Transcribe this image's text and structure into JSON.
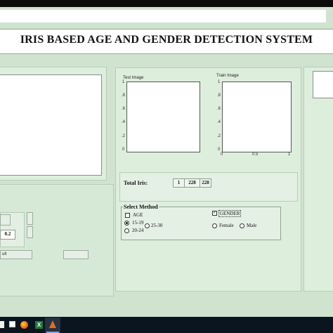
{
  "app": {
    "title": "IRIS BASED AGE AND GENDER DETECTION SYSTEM"
  },
  "plots": {
    "test": {
      "title": "Test Image",
      "yticks": [
        "1",
        ".8",
        ".6",
        ".4",
        ".2",
        "0"
      ]
    },
    "train": {
      "title": "Train Image",
      "yticks": [
        "1",
        ".8",
        ".6",
        ".4",
        ".2",
        "0"
      ],
      "xticks": [
        "0",
        "0.5",
        "1"
      ]
    }
  },
  "left": {
    "value_field": "0.2",
    "result_button": "ult"
  },
  "total": {
    "label": "Total Iris:",
    "values": [
      "1",
      "228",
      "228"
    ]
  },
  "method": {
    "legend": "Select Method",
    "age": {
      "label": "AGE",
      "checked": false
    },
    "gender": {
      "label": "GENDER",
      "checked": true
    },
    "age_options": [
      {
        "label": "15-19",
        "selected": true
      },
      {
        "label": "25-30",
        "selected": false
      },
      {
        "label": "20-24",
        "selected": false
      }
    ],
    "gender_options": [
      {
        "label": "Female",
        "selected": false
      },
      {
        "label": "Male",
        "selected": false
      }
    ]
  },
  "colors": {
    "window_bg": "#cfe3cf",
    "panel_bg": "#ddeedd",
    "taskbar": "#0b1520"
  },
  "taskbar": {
    "icons": [
      "windows-start-icon",
      "firefox-icon",
      "excel-icon",
      "matlab-icon"
    ]
  }
}
